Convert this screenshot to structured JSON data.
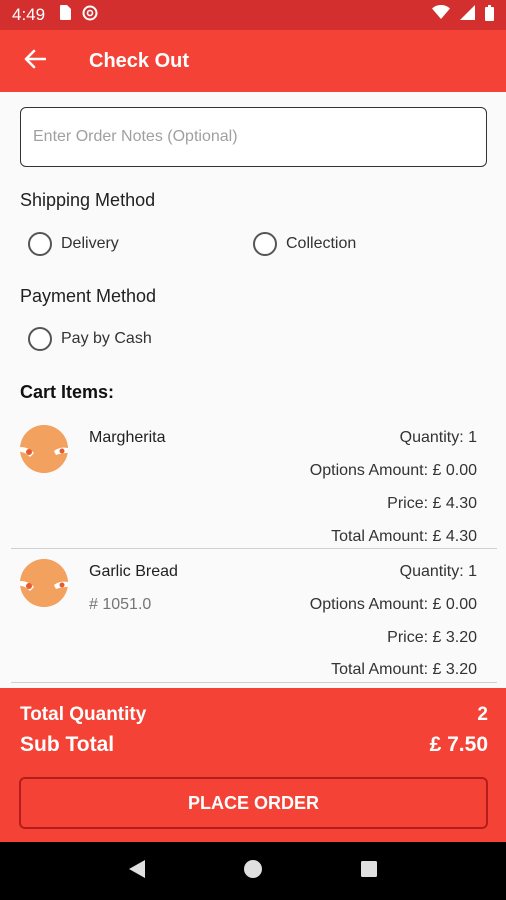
{
  "status_bar": {
    "time": "4:49"
  },
  "app_bar": {
    "title": "Check Out"
  },
  "notes": {
    "placeholder": "Enter Order Notes (Optional)",
    "value": ""
  },
  "shipping": {
    "title": "Shipping Method",
    "options": [
      "Delivery",
      "Collection"
    ]
  },
  "payment": {
    "title": "Payment Method",
    "options": [
      "Pay by Cash"
    ]
  },
  "cart": {
    "title": "Cart Items:",
    "items": [
      {
        "name": "Margherita",
        "code": "",
        "quantity": "Quantity: 1",
        "options_amount": "Options Amount: £ 0.00",
        "price": "Price: £ 4.30",
        "total_amount": "Total Amount: £ 4.30"
      },
      {
        "name": "Garlic Bread",
        "code": "# 1051.0",
        "quantity": "Quantity: 1",
        "options_amount": "Options Amount: £ 0.00",
        "price": "Price: £ 3.20",
        "total_amount": "Total Amount: £ 3.20"
      }
    ]
  },
  "summary": {
    "total_quantity_label": "Total Quantity",
    "total_quantity_value": "2",
    "sub_total_label": "Sub Total",
    "sub_total_value": "£ 7.50",
    "place_order_label": "PLACE ORDER"
  },
  "colors": {
    "primary": "#f44336",
    "status_bar": "#d32f2f",
    "accent_dark": "#b71c1c"
  },
  "icons": [
    "sim-card-icon",
    "no-disturb-icon",
    "wifi-icon",
    "signal-icon",
    "battery-icon",
    "back-arrow-icon",
    "food-thumbnail-icon",
    "nav-back-icon",
    "nav-home-icon",
    "nav-recents-icon"
  ]
}
